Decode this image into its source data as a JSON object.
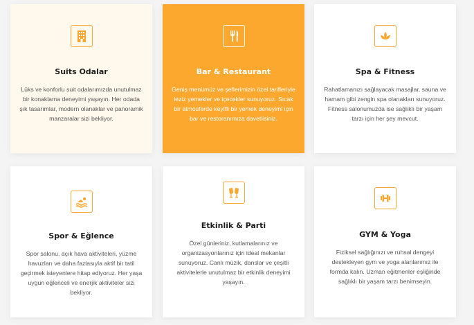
{
  "colors": {
    "accent": "#fca82f",
    "cream": "#fff8ec",
    "card": "#ffffff"
  },
  "services": [
    {
      "icon": "hotel-building-icon",
      "title": "Suits Odalar",
      "description": "Lüks ve konforlu suit odalarımızda unutulmaz bir konaklama deneyimi yaşayın. Her odada şık tasarımlar, modern olanaklar ve panoramik manzaralar sizi bekliyor."
    },
    {
      "icon": "fork-knife-icon",
      "title": "Bar & Restaurant",
      "description": "Geniş menümüz ve şeflerimizin özel tarifleriyle leziz yemekler ve içecekler sunuyoruz. Sıcak bir atmosferde keyifli bir yemek deneyimi için bar ve restoranımıza davetlisiniz."
    },
    {
      "icon": "lotus-icon",
      "title": "Spa & Fitness",
      "description": "Rahatlamanızı sağlayacak masajlar, sauna ve hamam gibi zengin spa olanakları sunuyoruz. Fitness salonumuzda ise sağlıklı bir yaşam tarzı için her şey mevcut."
    },
    {
      "icon": "swimmer-icon",
      "title": "Spor & Eğlence",
      "description": "Spor salonu, açık hava aktiviteleri, yüzme havuzları ve daha fazlasıyla aktif bir tatil geçirmek isteyenlere hitap ediyoruz. Her yaşa uygun eğlenceli ve enerjik aktiviteler sizi bekliyor."
    },
    {
      "icon": "champagne-glasses-icon",
      "title": "Etkinlik & Parti",
      "description": "Özel günleriniz, kutlamalarınız ve organizasyonlarınız için ideal mekanlar sunuyoruz. Canlı müzik, danslar ve çeşitli aktivitelerle unutulmaz bir etkinlik deneyimi yaşayın."
    },
    {
      "icon": "dumbbell-icon",
      "title": "GYM & Yoga",
      "description": "Fiziksel sağlığınızı ve ruhsal dengeyi destekleyen gym ve yoga alanlarımız ile formda kalın. Uzman eğitmenler eşliğinde sağlıklı bir yaşam tarzı benimseyin."
    }
  ]
}
